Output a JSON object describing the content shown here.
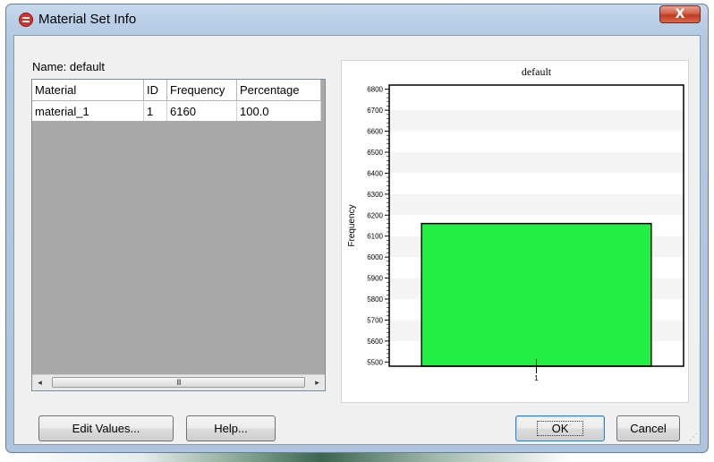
{
  "window": {
    "title": "Material Set Info",
    "close_glyph": "X"
  },
  "name_row": {
    "label": "Name:",
    "value": "default"
  },
  "table": {
    "columns": [
      "Material",
      "ID",
      "Frequency",
      "Percentage"
    ],
    "rows": [
      [
        "material_1",
        "1",
        "6160",
        "100.0"
      ]
    ]
  },
  "scrollbar": {
    "left_arrow": "◂",
    "right_arrow": "▸",
    "grip": "III"
  },
  "chart_data": {
    "type": "bar",
    "title": "default",
    "ylabel": "Frequency",
    "xlabel": "",
    "categories": [
      "1"
    ],
    "values": [
      6160
    ],
    "ylim": [
      5480,
      6820
    ],
    "yticks": [
      5500,
      5600,
      5700,
      5800,
      5900,
      6000,
      6100,
      6200,
      6300,
      6400,
      6500,
      6600,
      6700,
      6800
    ],
    "bar_color": "#22ee44",
    "grid": true
  },
  "buttons": {
    "edit_values": "Edit Values...",
    "help": "Help...",
    "ok": "OK",
    "cancel": "Cancel"
  },
  "colors": {
    "accent": "#3c7fb1",
    "close": "#c0391f"
  }
}
